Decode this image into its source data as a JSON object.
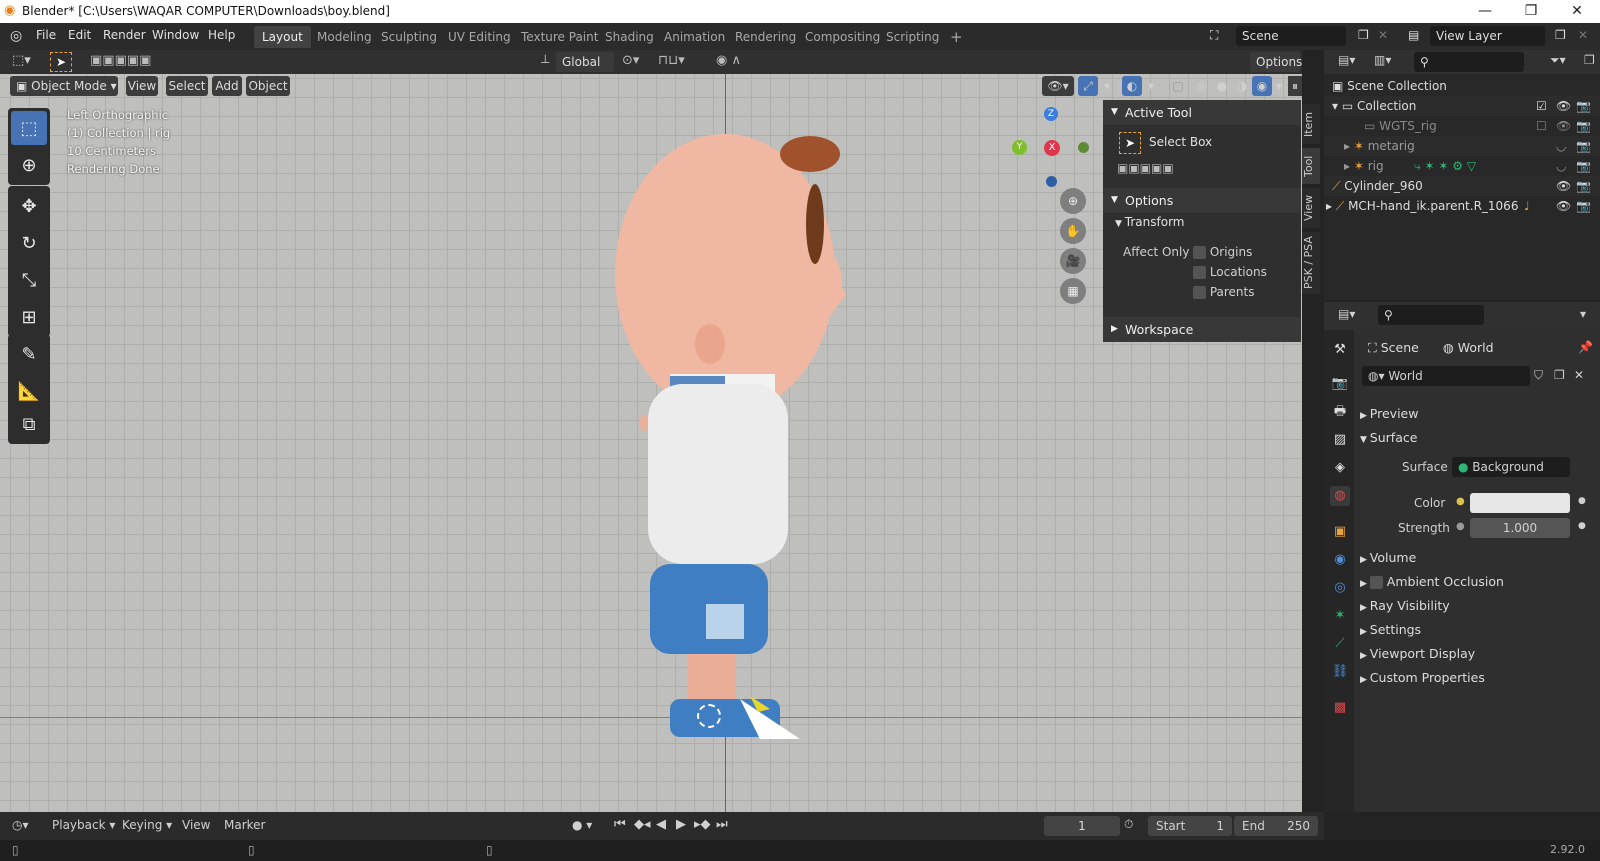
{
  "window": {
    "title": "Blender* [C:\\Users\\WAQAR COMPUTER\\Downloads\\boy.blend]",
    "min": "—",
    "max": "❐",
    "close": "✕"
  },
  "menus": [
    "File",
    "Edit",
    "Render",
    "Window",
    "Help"
  ],
  "workspaces": [
    "Layout",
    "Modeling",
    "Sculpting",
    "UV Editing",
    "Texture Paint",
    "Shading",
    "Animation",
    "Rendering",
    "Compositing",
    "Scripting"
  ],
  "scene": "Scene",
  "view_layer": "View Layer",
  "tool_header": {
    "orientation": "Global",
    "options": "Options"
  },
  "viewport_header": {
    "mode": "Object Mode",
    "menus": [
      "View",
      "Select",
      "Add",
      "Object"
    ]
  },
  "overlay": {
    "view": "Left Orthographic",
    "collection": "(1) Collection | rig",
    "scale": "10 Centimeters",
    "status": "Rendering Done"
  },
  "gizmo": {
    "z": "Z",
    "x": "X",
    "y": "Y"
  },
  "npanel": {
    "tabs": [
      "Item",
      "Tool",
      "View",
      "PSK / PSA"
    ],
    "active_tool": "Active Tool",
    "tool_name": "Select Box",
    "options": "Options",
    "transform": "Transform",
    "affect_only": "Affect Only",
    "checks": [
      "Origins",
      "Locations",
      "Parents"
    ],
    "workspace": "Workspace"
  },
  "outliner": {
    "root": "Scene Collection",
    "rows": [
      {
        "name": "Collection"
      },
      {
        "name": "WGTS_rig"
      },
      {
        "name": "metarig"
      },
      {
        "name": "rig"
      },
      {
        "name": "Cylinder_960"
      },
      {
        "name": "MCH-hand_ik.parent.R_1066"
      }
    ]
  },
  "properties": {
    "breadcrumb_scene": "Scene",
    "breadcrumb_world": "World",
    "world_name": "World",
    "sections": [
      "Preview",
      "Surface",
      "Volume",
      "Ambient Occlusion",
      "Ray Visibility",
      "Settings",
      "Viewport Display",
      "Custom Properties"
    ],
    "surface_label": "Surface",
    "surface_value": "Background",
    "color_label": "Color",
    "strength_label": "Strength",
    "strength_value": "1.000"
  },
  "timeline": {
    "menus": [
      "Playback",
      "Keying",
      "View",
      "Marker"
    ],
    "current_frame": "1",
    "start_label": "Start",
    "start": "1",
    "end_label": "End",
    "end": "250"
  },
  "version": "2.92.0",
  "colors": {
    "accent": "#4772b3",
    "viewport_bg": "#bfbfbd",
    "active_tab": "#424242"
  }
}
